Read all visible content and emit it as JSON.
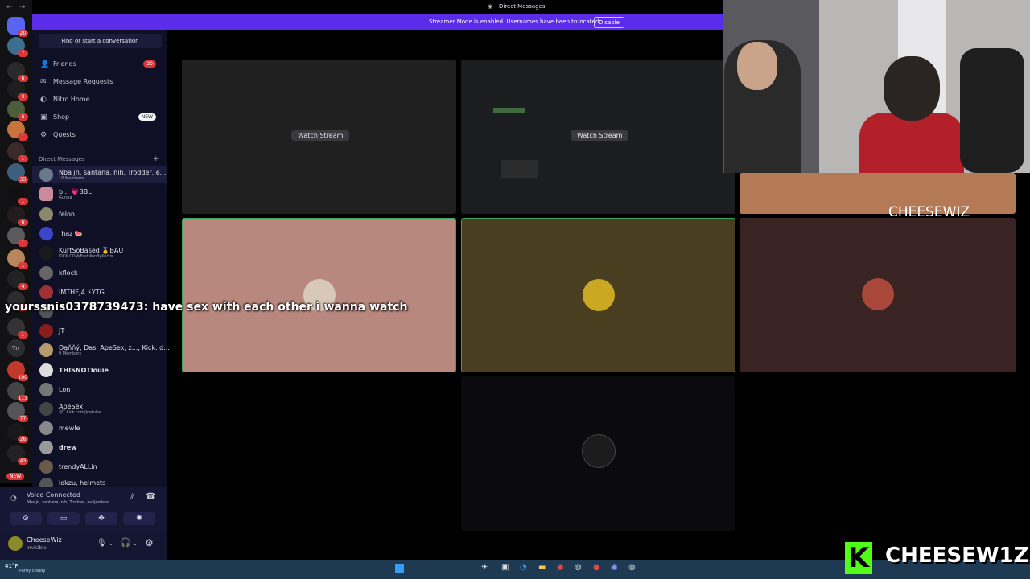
{
  "window": {
    "title": "Direct Messages"
  },
  "banner": {
    "text": "Streamer Mode is enabled. Usernames have been truncated.",
    "button": "Disable"
  },
  "colors": {
    "accent": "#5b2ce9",
    "danger": "#da373c",
    "sidebar": "#0f1026"
  },
  "server_rail": {
    "badges": [
      "20",
      "7",
      "6",
      "9",
      "6",
      "1",
      "1",
      "33",
      "1",
      "6",
      "1",
      "1",
      "4",
      "10",
      "1",
      "100",
      "113",
      "77",
      "26",
      "43"
    ],
    "text_server": "Yrr",
    "new_label": "NEW"
  },
  "sidebar": {
    "search_placeholder": "Find or start a conversation",
    "nav": [
      {
        "label": "Friends",
        "icon": "friends-icon",
        "badge": "20"
      },
      {
        "label": "Message Requests",
        "icon": "mail-icon"
      },
      {
        "label": "Nitro Home",
        "icon": "nitro-icon"
      },
      {
        "label": "Shop",
        "icon": "shop-icon",
        "badge": "NEW"
      },
      {
        "label": "Quests",
        "icon": "quests-icon"
      }
    ],
    "dm_header": "Direct Messages",
    "dms": [
      {
        "name": "Nba jn, santana, nih, Trodder, e...",
        "sub": "10 Members"
      },
      {
        "name": "b... 💗BBL",
        "sub": "Gunna"
      },
      {
        "name": "felon",
        "sub": ""
      },
      {
        "name": "!haz 🍉",
        "sub": ""
      },
      {
        "name": "KurtSoBased 🏅BAU",
        "sub": "KICK.COM/FastMon3yKurtis"
      },
      {
        "name": "kflock",
        "sub": ""
      },
      {
        "name": "IMTHEJ4 ⚡YTG",
        "sub": ""
      },
      {
        "name": "",
        "sub": ""
      },
      {
        "name": "JT",
        "sub": ""
      },
      {
        "name": "Ðąňňý, Das, ApeSex, z..., Kick: d...",
        "sub": "9 Members"
      },
      {
        "name": "THISNOTlouie",
        "sub": ""
      },
      {
        "name": "Lon",
        "sub": ""
      },
      {
        "name": "ApeSex",
        "sub": "😴 kick.com/joetube"
      },
      {
        "name": "mewle",
        "sub": ""
      },
      {
        "name": "drew",
        "sub": ""
      },
      {
        "name": "trendyALLin",
        "sub": ""
      },
      {
        "name": "lokzu, helmets",
        "sub": ""
      }
    ]
  },
  "voice": {
    "status": "Voice Connected",
    "members": "Nba jn, santana, nih, Trodder, evlijordann..."
  },
  "user": {
    "name": "CheeseWiz",
    "status": "Invisible"
  },
  "stage": {
    "watch_stream_label": "Watch Stream"
  },
  "overlay": {
    "webcam_name": "CHEESEWIZ",
    "chat_message": "yourssnis0378739473: have sex with each other i wanna watch",
    "logo_letter": "K",
    "logo_text": "CHEESEW1Z"
  },
  "taskbar": {
    "weather_temp": "41°F",
    "weather_desc": "Partly cloudy"
  }
}
